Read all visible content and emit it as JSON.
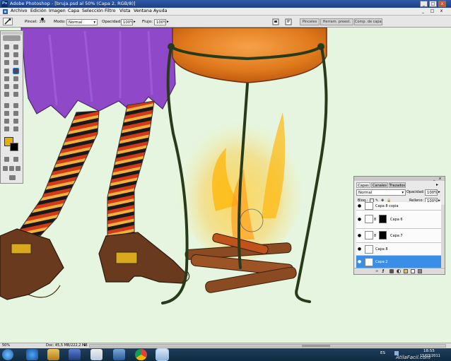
{
  "app": {
    "icon_text": "Ps",
    "title": "Adobe Photoshop - [bruja.psd al 50% (Capa 2, RGB/8)]",
    "window_buttons": {
      "minimize": "_",
      "restore": "□",
      "close": "x"
    }
  },
  "menu": [
    "Archivo",
    "Edición",
    "Imagen",
    "Capa",
    "Selección",
    "Filtro",
    "Vista",
    "Ventana",
    "Ayuda"
  ],
  "options": {
    "brush_label": "Pincel:",
    "brush_size": "200",
    "mode_label": "Modo:",
    "mode_value": "Normal",
    "opacity_label": "Opacidad:",
    "opacity_value": "100%",
    "flow_label": "Flujo:",
    "flow_value": "100%"
  },
  "palette_well_tabs": [
    "Pinceles",
    "Herram. preest.",
    "Comp. de capas"
  ],
  "colors": {
    "foreground": "#e9b000",
    "background": "#000000",
    "selected_layer": "#3a8ee6",
    "canvas": "#e5f5df"
  },
  "layers_panel": {
    "tabs": [
      "Capas",
      "Canales",
      "Trazados"
    ],
    "blend_mode": "Normal",
    "opacity_label": "Opacidad:",
    "opacity_value": "100%",
    "lock_label": "Bloq.:",
    "fill_label": "Relleno:",
    "fill_value": "100%",
    "layers": [
      {
        "name": "Capa 8 copia",
        "has_mask": false,
        "selected": false
      },
      {
        "name": "Capa 6",
        "has_mask": true,
        "selected": false
      },
      {
        "name": "Capa 7",
        "has_mask": true,
        "selected": false
      },
      {
        "name": "Capa 8",
        "has_mask": false,
        "selected": false
      },
      {
        "name": "Capa 2",
        "has_mask": false,
        "selected": true
      }
    ]
  },
  "status": {
    "zoom": "50%",
    "doc_info": "Doc: 45,5 MB/222,2 MB"
  },
  "taskbar": {
    "language": "ES",
    "time": "18:55",
    "date": "15/03/2011",
    "watermark": "AtilaFacil.com",
    "apps": [
      "start-orb",
      "internet-explorer",
      "windows-explorer",
      "media-player",
      "paint",
      "network",
      "chrome",
      "photoshop"
    ]
  }
}
